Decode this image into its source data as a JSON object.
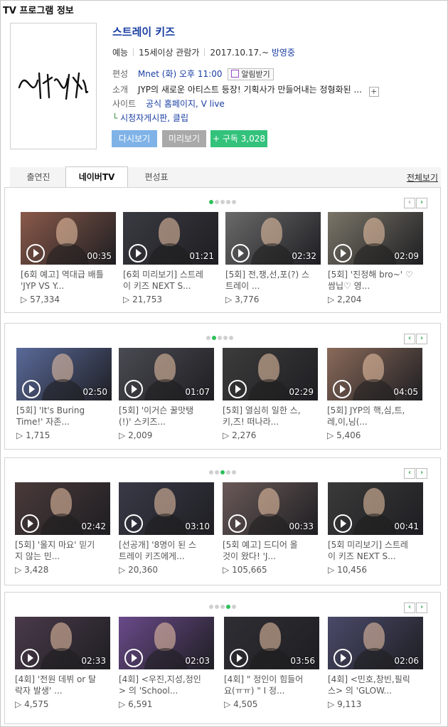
{
  "section_title": "TV 프로그램 정보",
  "program": {
    "title": "스트레이 키즈",
    "genre": "예능",
    "rating": "15세이상 관람가",
    "air_date": "2017.10.17.~",
    "status": "방영중",
    "schedule_label": "편성",
    "schedule": "Mnet (화) 오후 11:00",
    "alarm_label": "알림받기",
    "intro_label": "소개",
    "intro": "JYP의 새로운 아티스트 등장! 기획사가 만들어내는 정형화된 ...",
    "site_label": "사이트",
    "site_links": "공식 홈페이지, V live",
    "viewer_links": "시청자게시판, 클립",
    "poster_alt": "Stray Kids"
  },
  "buttons": {
    "replay": "다시보기",
    "preview": "미리보기",
    "subscribe": "+ 구독 3,028"
  },
  "tabs": [
    "출연진",
    "네이버TV",
    "편성표"
  ],
  "all_link": "전체보기",
  "panels": [
    {
      "videos": [
        {
          "duration": "00:35",
          "title1": "[6회 예고] 역대급 배틀",
          "title2": "'JYP VS Y...",
          "views": "57,334",
          "color": "#8a5a4a"
        },
        {
          "duration": "01:21",
          "title1": "[6회 미리보기] 스트레",
          "title2": "이 키즈 NEXT S...",
          "views": "21,753",
          "color": "#3a3a42"
        },
        {
          "duration": "02:32",
          "title1": "[5회] 전,쟁,선,포(?) 스",
          "title2": "트레이 ...",
          "views": "3,776",
          "color": "#6a6a6a"
        },
        {
          "duration": "02:09",
          "title1": "[5회] '진정해 bro~' ♡",
          "title2": "쌈닙♡ 영...",
          "views": "2,204",
          "color": "#7a7568"
        }
      ]
    },
    {
      "videos": [
        {
          "duration": "02:50",
          "title1": "[5회] 'It's Buring",
          "title2": "Time!' 자존...",
          "views": "1,715",
          "color": "#5a6a9a"
        },
        {
          "duration": "01:07",
          "title1": "[5회] '이거슨 꿀맛탱",
          "title2": "(!)' 스키즈...",
          "views": "2,009",
          "color": "#4a4a52"
        },
        {
          "duration": "02:29",
          "title1": "[5회] 열심히 일한 스,",
          "title2": "키,즈! 떠나라...",
          "views": "2,276",
          "color": "#3c3c3c"
        },
        {
          "duration": "04:05",
          "title1": "[5회] JYP의 핵,심,트,",
          "title2": "레,이,닝(...",
          "views": "5,406",
          "color": "#8a6a5a"
        }
      ]
    },
    {
      "videos": [
        {
          "duration": "02:42",
          "title1": "[5회] '울지 마요' 믿기",
          "title2": "지 않는 민...",
          "views": "3,428",
          "color": "#4a3a3a"
        },
        {
          "duration": "03:10",
          "title1": "[선공개] '8명이 된 스",
          "title2": "트레이 키즈에게...",
          "views": "20,360",
          "color": "#3a3a48"
        },
        {
          "duration": "00:33",
          "title1": "[5회 예고] 드디어 올",
          "title2": "것이 왔다! 'J...",
          "views": "105,665",
          "color": "#6a5a58"
        },
        {
          "duration": "00:41",
          "title1": "[5회 미리보기] 스트레",
          "title2": "이 키즈 NEXT S...",
          "views": "10,456",
          "color": "#3a3a3a"
        }
      ]
    },
    {
      "videos": [
        {
          "duration": "02:33",
          "title1": "[4회] '전원 데뷔 or 탈",
          "title2": "락자 발생' ...",
          "views": "4,575",
          "color": "#4a3a4a"
        },
        {
          "duration": "02:03",
          "title1": "[4회] <우진,지성,정인",
          "title2": "> 의 'School...",
          "views": "6,591",
          "color": "#6a4a8a"
        },
        {
          "duration": "03:56",
          "title1": "[4회] \" 정인이 힘들어",
          "title2": "요(ㅠㅠ) \" I 정...",
          "views": "4,505",
          "color": "#2e2e34"
        },
        {
          "duration": "02:06",
          "title1": "[4회] <민호,창빈,필릭",
          "title2": "스> 의 'GLOW...",
          "views": "9,113",
          "color": "#4a4a6a"
        }
      ]
    }
  ],
  "colors": {
    "title_blue": "#1a3fa3",
    "replay_btn": "#7fb3e8",
    "preview_btn": "#a9a9a9",
    "subscribe_btn": "#33c27b",
    "dot_active": "#2ec05a"
  }
}
